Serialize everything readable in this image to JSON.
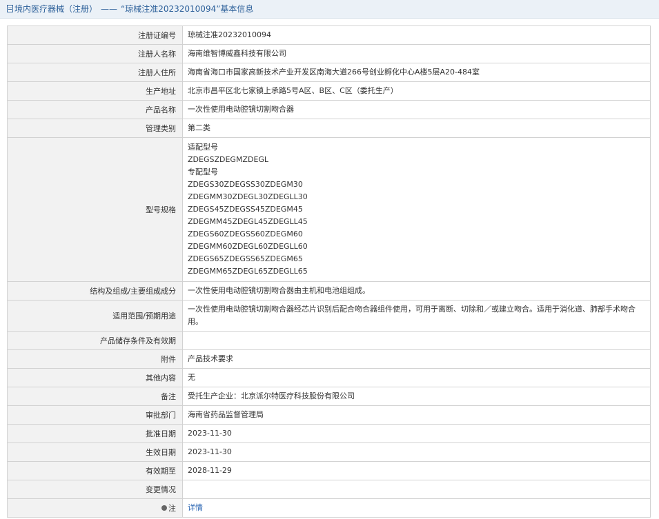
{
  "header": {
    "section": "境内医疗器械（注册）",
    "separator": "——",
    "title": "“琼械注准20232010094”基本信息"
  },
  "rows": [
    {
      "label": "注册证编号",
      "value": "琼械注准20232010094"
    },
    {
      "label": "注册人名称",
      "value": "海南维智博威鑫科技有限公司"
    },
    {
      "label": "注册人住所",
      "value": "海南省海口市国家高新技术产业开发区南海大道266号创业孵化中心A楼5层A20-484室"
    },
    {
      "label": "生产地址",
      "value": "北京市昌平区北七家镇上承路5号A区、B区、C区（委托生产）"
    },
    {
      "label": "产品名称",
      "value": "一次性使用电动腔镜切割吻合器"
    },
    {
      "label": "管理类别",
      "value": "第二类"
    }
  ],
  "models": {
    "label": "型号规格",
    "lines": [
      "适配型号",
      "ZDEGSZDEGMZDEGL",
      "专配型号",
      "ZDEGS30ZDEGSS30ZDEGM30",
      "ZDEGMM30ZDEGL30ZDEGLL30",
      "ZDEGS45ZDEGSS45ZDEGM45",
      "ZDEGMM45ZDEGL45ZDEGLL45",
      "ZDEGS60ZDEGSS60ZDEGM60",
      "ZDEGMM60ZDEGL60ZDEGLL60",
      "ZDEGS65ZDEGSS65ZDEGM65",
      "ZDEGMM65ZDEGL65ZDEGLL65"
    ]
  },
  "structure": {
    "label": "结构及组成/主要组成成分",
    "value": "一次性使用电动腔镜切割吻合器由主机和电池组组成。"
  },
  "scope": {
    "label": "适用范围/预期用途",
    "value": "一次性使用电动腔镜切割吻合器经芯片识别后配合吻合器组件使用，可用于离断、切除和／或建立吻合。适用于消化道、肺部手术吻合用。"
  },
  "rows2": [
    {
      "label": "产品储存条件及有效期",
      "value": ""
    },
    {
      "label": "附件",
      "value": "产品技术要求"
    },
    {
      "label": "其他内容",
      "value": "无"
    },
    {
      "label": "备注",
      "value": "受托生产企业：北京派尔特医疗科技股份有限公司"
    },
    {
      "label": "审批部门",
      "value": "海南省药品监督管理局"
    },
    {
      "label": "批准日期",
      "value": "2023-11-30"
    },
    {
      "label": "生效日期",
      "value": "2023-11-30"
    },
    {
      "label": "有效期至",
      "value": "2028-11-29"
    },
    {
      "label": "变更情况",
      "value": ""
    }
  ],
  "note": {
    "label": "注",
    "link": "详情",
    "icon": "note-icon"
  }
}
